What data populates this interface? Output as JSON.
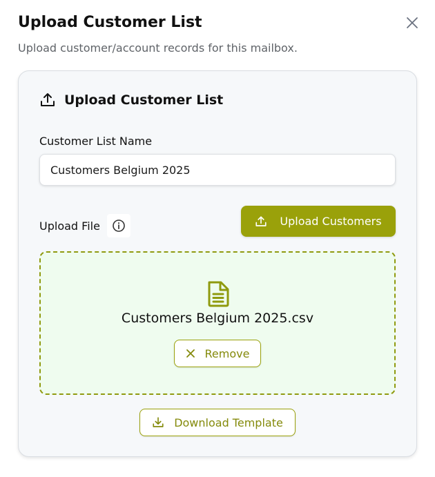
{
  "dialog": {
    "title": "Upload Customer List",
    "subtitle": "Upload customer/account records for this mailbox.",
    "close_icon": "close-icon"
  },
  "card": {
    "title": "Upload Customer List",
    "title_icon": "upload-icon",
    "list_name_label": "Customer List Name",
    "list_name_value": "Customers Belgium 2025",
    "upload_file_label": "Upload File",
    "info_icon": "info-icon",
    "upload_button_label": "Upload Customers",
    "upload_button_icon": "upload-icon",
    "dropzone": {
      "file_icon": "file-document-icon",
      "file_name": "Customers Belgium 2025.csv",
      "remove_label": "Remove",
      "remove_icon": "close-icon"
    },
    "download_template_label": "Download Template",
    "download_icon": "download-icon"
  },
  "colors": {
    "accent": "#9aa10a",
    "accent_text": "#848a0b",
    "dropzone_bg": "#effcef",
    "card_bg": "#f6f8fa"
  }
}
